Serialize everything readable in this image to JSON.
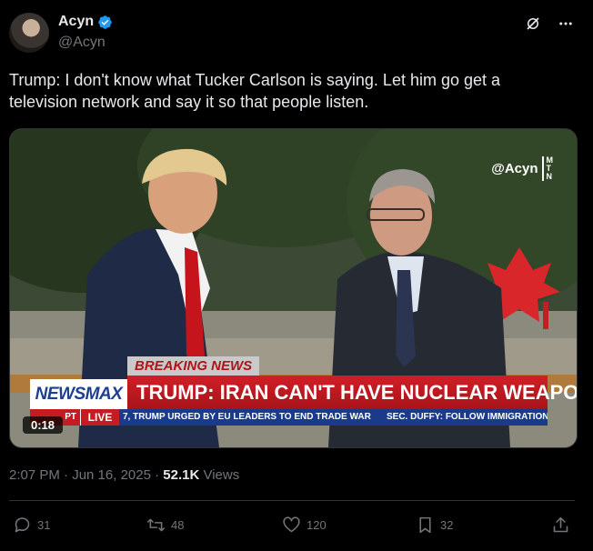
{
  "author": {
    "display_name": "Acyn",
    "handle": "@Acyn",
    "verified": true
  },
  "tweet": {
    "text": "Trump: I don't know what Tucker Carlson is saying. Let him go get a television network and say it so that people listen."
  },
  "media": {
    "watermark": "@Acyn",
    "watermark_logo": [
      "M",
      "T",
      "N"
    ],
    "duration": "0:18",
    "chyron": {
      "breaking": "BREAKING NEWS",
      "headline": "TRUMP: IRAN CAN'T HAVE NUCLEAR WEAPON",
      "network": "NEWSMAX",
      "ticker_prefix": "PT",
      "live": "LIVE",
      "ticker_item_1": "7, TRUMP URGED BY EU LEADERS TO END TRADE WAR",
      "ticker_item_2": "SEC. DUFFY: FOLLOW IMMIGRATION"
    }
  },
  "meta": {
    "timestamp": "2:07 PM · Jun 16, 2025 · ",
    "views_count": "52.1K",
    "views_label": " Views"
  },
  "actions": {
    "replies": "31",
    "reposts": "48",
    "likes": "120",
    "bookmarks": "32"
  },
  "colors": {
    "background": "#000000",
    "text": "#e7e9ea",
    "muted": "#71767b",
    "verified": "#1d9bf0",
    "chyron_red": "#d11f26",
    "ticker_blue": "#1a3b8c"
  }
}
